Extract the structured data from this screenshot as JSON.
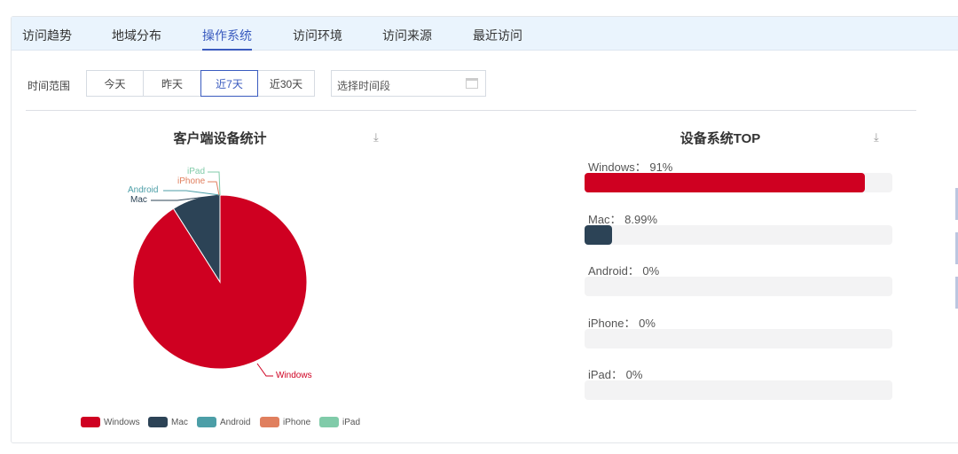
{
  "tabs": [
    "访问趋势",
    "地域分布",
    "操作系统",
    "访问环境",
    "访问来源",
    "最近访问"
  ],
  "active_tab": 2,
  "filter": {
    "label": "时间范围",
    "options": [
      "今天",
      "昨天",
      "近7天",
      "近30天"
    ],
    "active": 2,
    "date_placeholder": "选择时间段"
  },
  "colors": {
    "Windows": "#cf0021",
    "Mac": "#2c4356",
    "Android": "#4c9ea7",
    "iPhone": "#e07f5e",
    "iPad": "#80cba9",
    "accent": "#3a5bbf"
  },
  "chart_data": {
    "type": "pie",
    "title": "客户端设备统计",
    "categories": [
      "Windows",
      "Mac",
      "Android",
      "iPhone",
      "iPad"
    ],
    "values": [
      91,
      8.99,
      0,
      0,
      0
    ],
    "legend": "bottom"
  },
  "top": {
    "title": "设备系统TOP",
    "items": [
      {
        "name": "Windows",
        "pct": 91,
        "label": "Windows：  91%"
      },
      {
        "name": "Mac",
        "pct": 8.99,
        "label": "Mac：  8.99%"
      },
      {
        "name": "Android",
        "pct": 0,
        "label": "Android：  0%"
      },
      {
        "name": "iPhone",
        "pct": 0,
        "label": "iPhone：  0%"
      },
      {
        "name": "iPad",
        "pct": 0,
        "label": "iPad：  0%"
      }
    ]
  }
}
